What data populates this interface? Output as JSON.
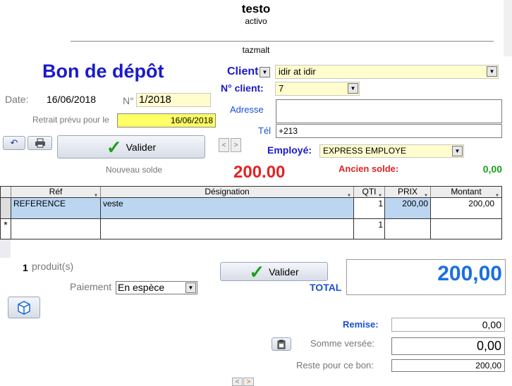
{
  "header": {
    "title": "testo",
    "subtitle": "activo",
    "company": "tazmalt"
  },
  "form_title": "Bon de dépôt",
  "date": {
    "label": "Date:",
    "value": "16/06/2018"
  },
  "number": {
    "label": "N°",
    "value": "1/2018"
  },
  "pickup": {
    "label": "Retrait prévu pour le",
    "value": "16/06/2018"
  },
  "client": {
    "label": "Client",
    "value": "idir at idir"
  },
  "client_no": {
    "label": "N° client:",
    "value": "7"
  },
  "address": {
    "label": "Adresse",
    "value": ""
  },
  "phone": {
    "label": "Tél",
    "value": "+213"
  },
  "employee": {
    "label": "Employé:",
    "value": "EXPRESS EMPLOYE"
  },
  "toolbar": {
    "validate_label": "Valider",
    "undo_icon": "undo-icon",
    "print_icon": "printer-icon",
    "prev": "<",
    "next": ">"
  },
  "new_balance": {
    "label": "Nouveau solde",
    "value": "200.00"
  },
  "old_balance": {
    "label": "Ancien solde:",
    "value": "0,00"
  },
  "table": {
    "columns": [
      "Réf",
      "Désignation",
      "QTI",
      "PRIX",
      "Montant"
    ],
    "rows": [
      {
        "ref": "REFERENCE",
        "designation": "veste",
        "qty": "1",
        "price": "200,00",
        "amount": "200,00"
      },
      {
        "ref": "",
        "designation": "",
        "qty": "1",
        "price": "",
        "amount": "",
        "marker": "*"
      }
    ]
  },
  "products": {
    "count": "1",
    "label": "produit(s)"
  },
  "payment": {
    "label": "Paiement",
    "value": "En espèce"
  },
  "validate2_label": "Valider",
  "total": {
    "label": "TOTAL",
    "value": "200,00"
  },
  "discount": {
    "label": "Remise:",
    "value": "0,00"
  },
  "paid": {
    "label": "Somme versée:",
    "value": "0,00"
  },
  "remaining": {
    "label": "Reste pour ce bon:",
    "value": "200,00"
  },
  "bottom_nav": {
    "prev": "<",
    "next": ">"
  },
  "colors": {
    "accent_blue": "#1a1acc",
    "red": "#e02424",
    "green": "#1aa01a",
    "yellow": "#fffccd",
    "highlight": "#ffff66",
    "row_select": "#bcd6f2"
  }
}
